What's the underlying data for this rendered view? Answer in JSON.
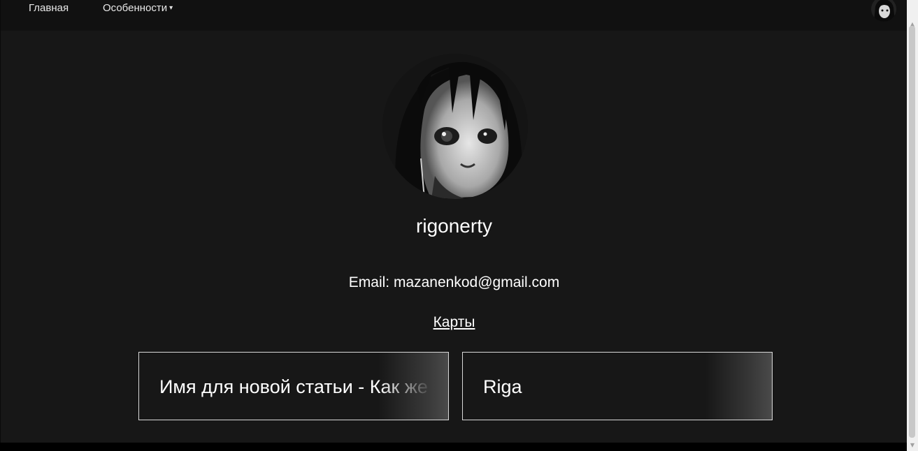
{
  "nav": {
    "home_label": "Главная",
    "features_label": "Особенности",
    "features_caret": "▾",
    "avatar_icon": "user-avatar-icon"
  },
  "profile": {
    "username": "rigonerty",
    "email_text": "Email: mazanenkod@gmail.com",
    "cards_link": "Карты",
    "avatar_icon": "profile-avatar-icon"
  },
  "cards": [
    {
      "title": "Имя для новой статьи - Как же"
    },
    {
      "title": "Riga"
    }
  ],
  "colors": {
    "background": "#171717",
    "nav_background": "#111111",
    "text": "#ffffff",
    "card_border": "#d9d9d9"
  }
}
